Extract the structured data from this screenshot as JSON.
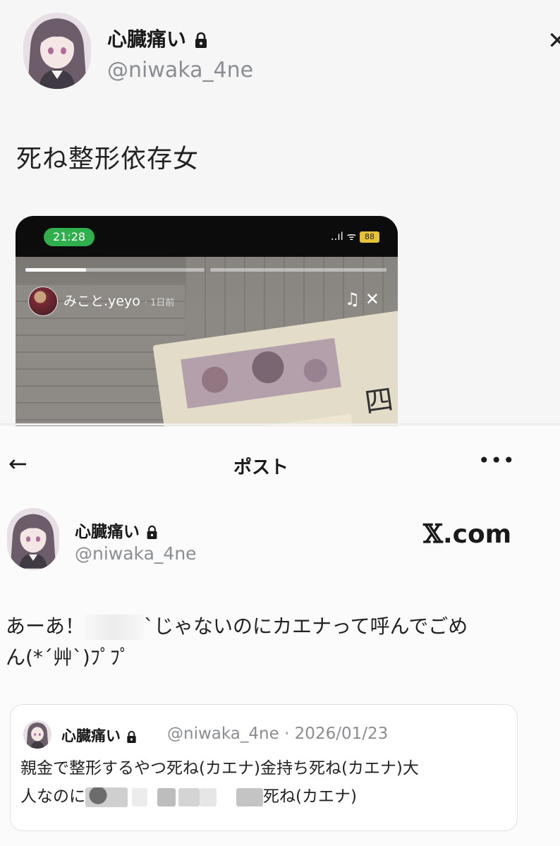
{
  "top_post": {
    "display_name": "心臓痛い",
    "handle": "@niwaka_4ne",
    "close_glyph": "✕",
    "text": "死ね整形依存女",
    "embedded_image": {
      "status_time": "21:28",
      "status_icons": "..ıl ᯤ",
      "battery_label": "88",
      "story_user": "みこと.yeyo",
      "story_ago": "1日前",
      "story_controls": "♫ ✕",
      "bill_char": "四"
    }
  },
  "bottom_nav": {
    "back_glyph": "←",
    "title": "ポスト",
    "more_glyph": "•••"
  },
  "bottom_post": {
    "display_name": "心臓痛い",
    "handle": "@niwaka_4ne",
    "watermark_x": "𝕏",
    "watermark_com": ".com",
    "text_part1": "あーあ！",
    "text_part2": "`じゃないのにカエナって呼んでごめ",
    "text_line2": "ん(*´艸`)ﾌﾟﾌﾟ"
  },
  "quote": {
    "display_name": "心臓痛い",
    "handle_date": "@niwaka_4ne · 2026/01/23",
    "line1": "親金で整形するやつ死ね(カエナ)金持ち死ね(カエナ)大",
    "line2_start": "人なのに",
    "line2_end": "死ね(カエナ)"
  },
  "icons": {
    "lock": "lock-icon",
    "back": "arrow-left-icon",
    "more": "more-horizontal-icon",
    "close": "close-icon"
  },
  "colors": {
    "handle_gray": "#8a8d92",
    "status_green": "#2fb04c"
  }
}
